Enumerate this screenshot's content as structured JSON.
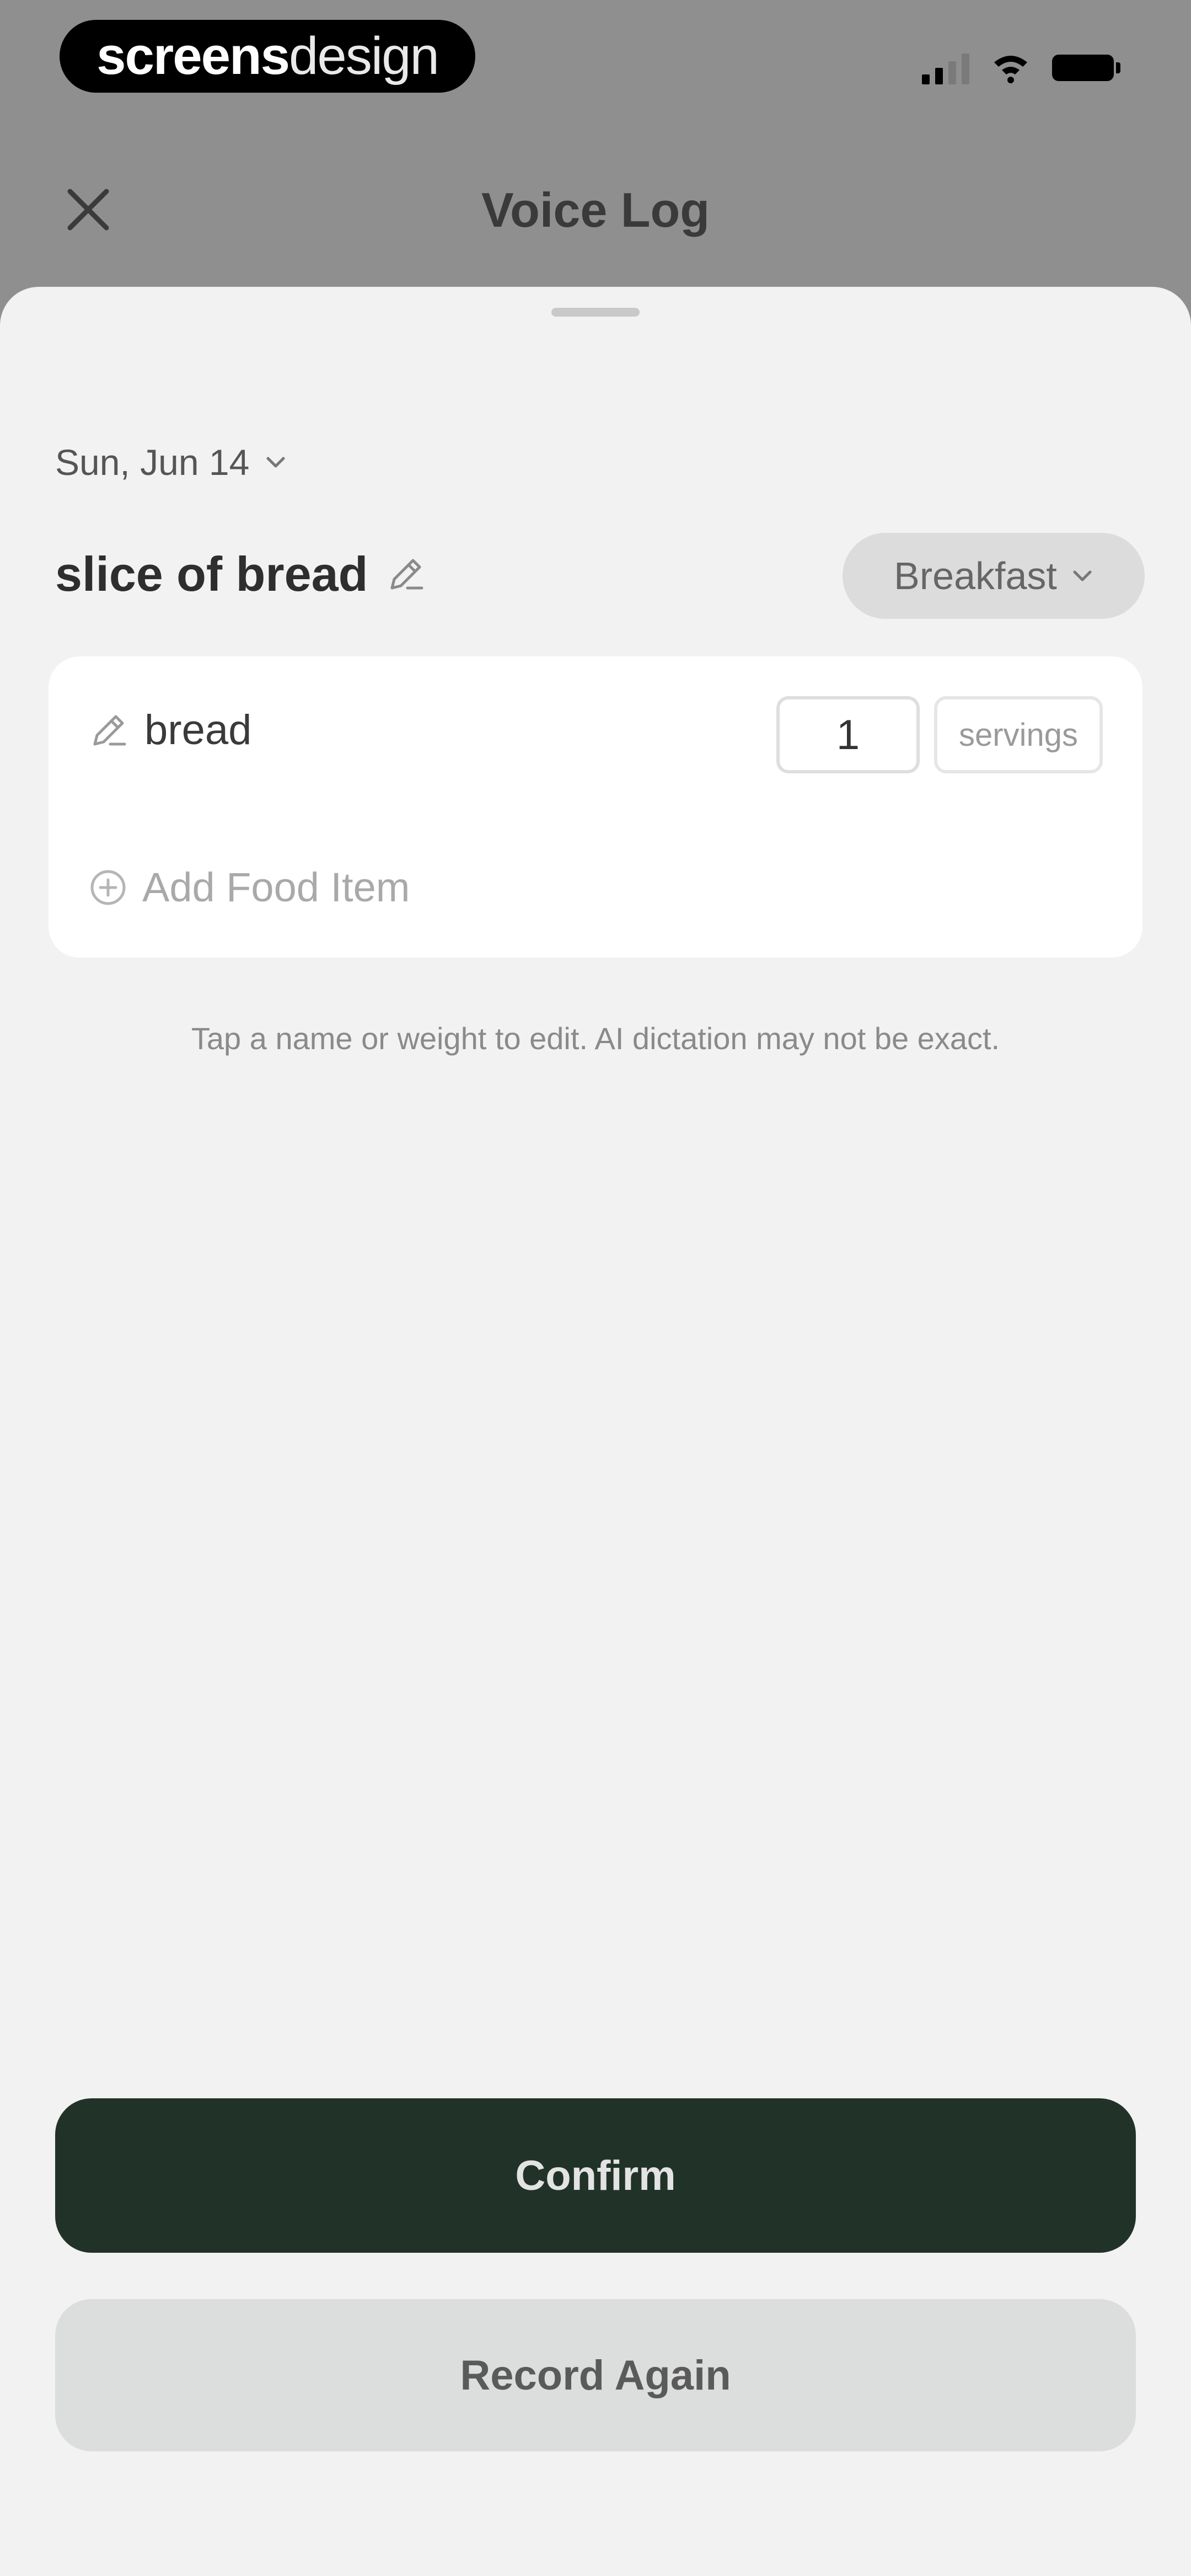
{
  "status_bar": {
    "brand_bold": "screens",
    "brand_light": "design"
  },
  "header": {
    "title": "Voice Log",
    "close_icon": "close-icon"
  },
  "date_selector": {
    "label": "Sun, Jun 14"
  },
  "meal": {
    "title": "slice of bread",
    "type_label": "Breakfast"
  },
  "food_items": [
    {
      "name": "bread",
      "quantity": "1",
      "unit": "servings"
    }
  ],
  "add_item_label": "Add Food Item",
  "hint": "Tap a name or weight to edit. AI dictation may not be exact.",
  "actions": {
    "confirm_label": "Confirm",
    "record_again_label": "Record Again"
  },
  "colors": {
    "primary_button": "#213329",
    "secondary_button": "#dcdddd",
    "sheet_background": "#f2f2f2",
    "overlay": "#8f8f8f"
  }
}
